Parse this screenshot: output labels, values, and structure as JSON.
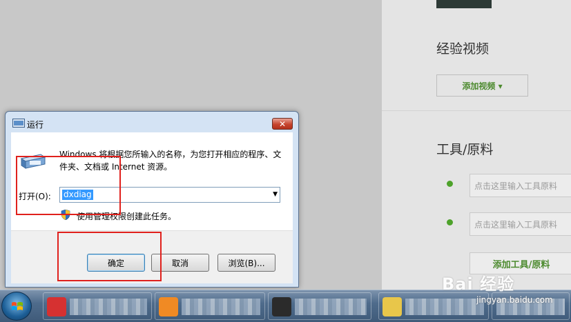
{
  "background_page": {
    "section_video_title": "经验视频",
    "add_video_button": "添加视频 ▾",
    "section_tools_title": "工具/原料",
    "tool_input_placeholder_1": "点击这里输入工具原料",
    "tool_input_placeholder_2": "点击这里输入工具原料",
    "add_tool_button": "添加工具/原料",
    "watermark_text": "Bai 经验",
    "watermark_url": "jingyan.baidu.com"
  },
  "dialog": {
    "title": "运行",
    "close_label": "✕",
    "description": "Windows 将根据您所输入的名称，为您打开相应的程序、文件夹、文档或 Internet 资源。",
    "open_label": "打开(O):",
    "open_value": "dxdiag",
    "admin_note": "使用管理权限创建此任务。",
    "buttons": {
      "ok": "确定",
      "cancel": "取消",
      "browse": "浏览(B)..."
    }
  },
  "colors": {
    "highlight_box": "#e0201c",
    "selection": "#3399ff",
    "accent_green": "#4c8a2e"
  },
  "taskbar": {
    "items": [
      "chrome-like-icon",
      "orange-app-icon",
      "dark-app-icon",
      "folder-icon"
    ]
  }
}
